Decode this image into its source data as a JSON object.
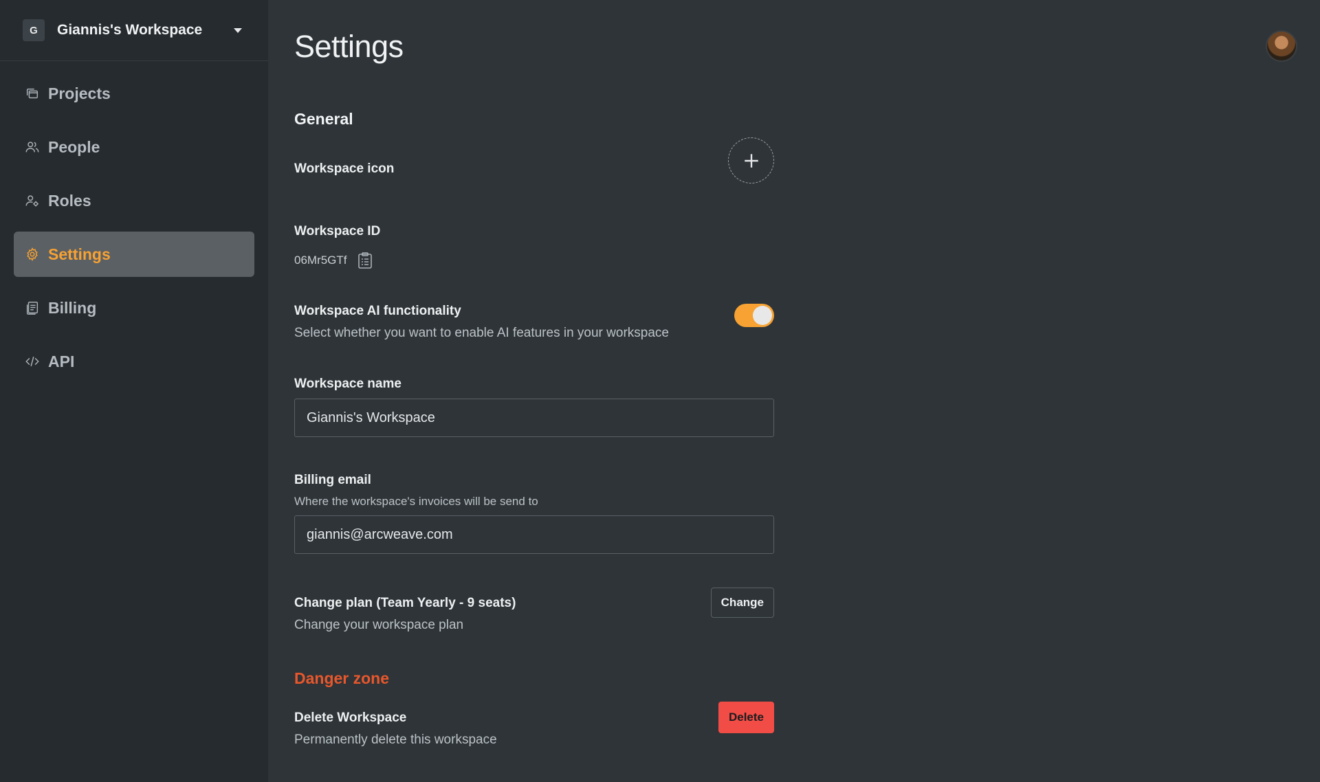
{
  "sidebar": {
    "workspace_badge": "G",
    "workspace_name": "Giannis's Workspace",
    "items": [
      {
        "label": "Projects",
        "icon": "projects-icon",
        "active": false
      },
      {
        "label": "People",
        "icon": "people-icon",
        "active": false
      },
      {
        "label": "Roles",
        "icon": "roles-icon",
        "active": false
      },
      {
        "label": "Settings",
        "icon": "gear-icon",
        "active": true
      },
      {
        "label": "Billing",
        "icon": "billing-icon",
        "active": false
      },
      {
        "label": "API",
        "icon": "code-icon",
        "active": false
      }
    ]
  },
  "header": {
    "title": "Settings"
  },
  "general": {
    "section_title": "General",
    "workspace_icon_label": "Workspace icon",
    "workspace_id_label": "Workspace ID",
    "workspace_id_value": "06Mr5GTf",
    "ai_label": "Workspace AI functionality",
    "ai_description": "Select whether you want to enable AI features in your workspace",
    "ai_enabled": true,
    "name_label": "Workspace name",
    "name_value": "Giannis's Workspace",
    "billing_label": "Billing email",
    "billing_description": "Where the workspace's invoices will be send to",
    "billing_value": "giannis@arcweave.com",
    "plan_label": "Change plan (Team Yearly - 9 seats)",
    "plan_description": "Change your workspace plan",
    "plan_button": "Change"
  },
  "danger": {
    "section_title": "Danger zone",
    "delete_label": "Delete Workspace",
    "delete_description": "Permanently delete this workspace",
    "delete_button": "Delete"
  },
  "colors": {
    "accent": "#f7a233",
    "danger_title": "#e8572c",
    "danger_button": "#f24c46"
  }
}
